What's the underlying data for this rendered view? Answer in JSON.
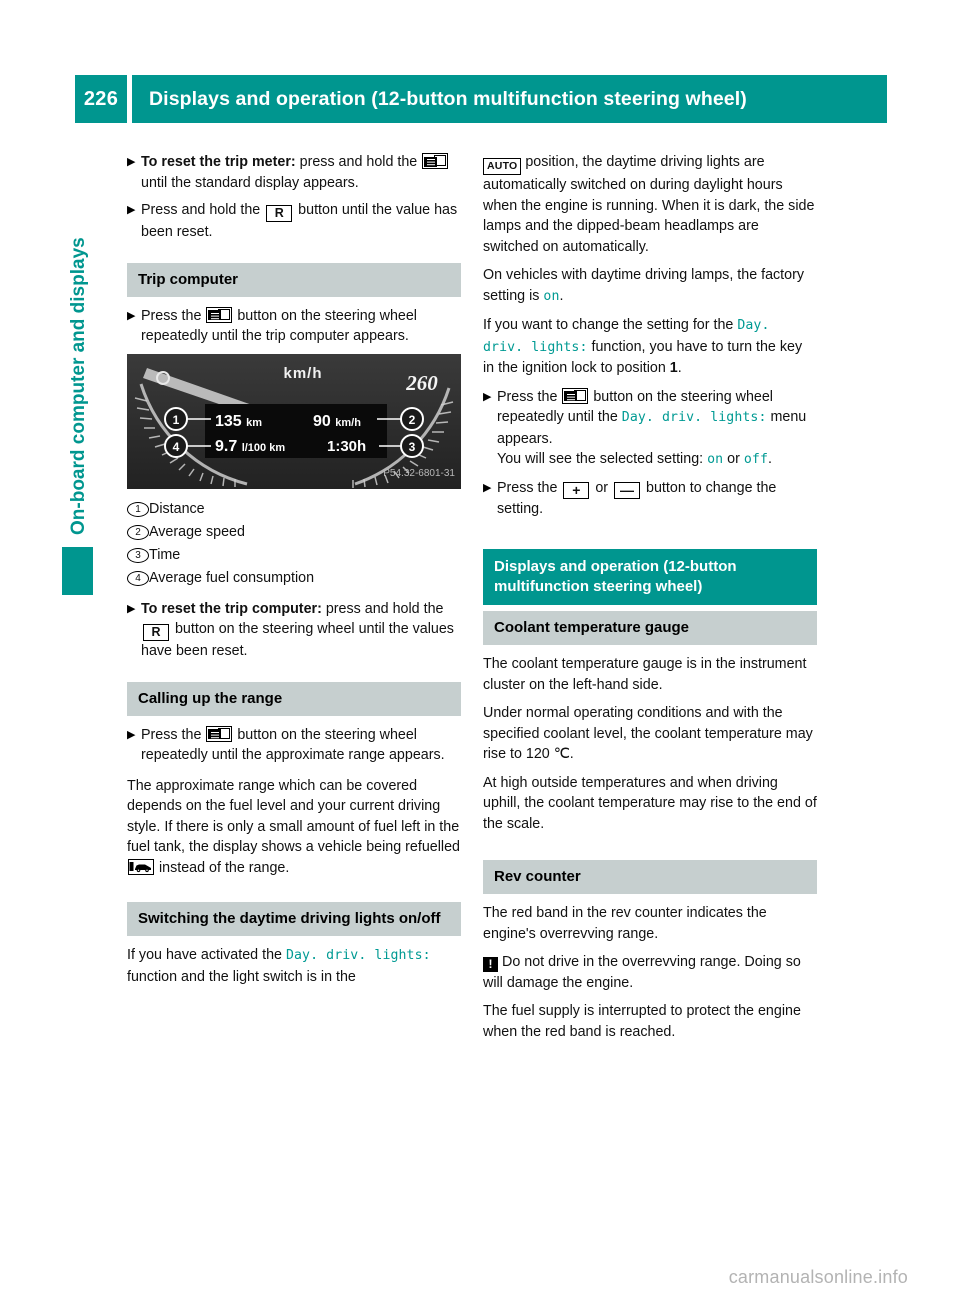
{
  "header": {
    "page_number": "226",
    "title": "Displays and operation (12-button multifunction steering wheel)",
    "accent_color": "#00968f"
  },
  "side_tab": {
    "label": "On-board computer and displays",
    "color": "#00968f"
  },
  "icons": {
    "menu_button": "menu-display-button-icon",
    "reset_button": "R",
    "auto_badge": "AUTO",
    "plus_button": "+",
    "minus_button": "—",
    "refuel": "refuel-vehicle-icon",
    "warning": "!"
  },
  "left_column": {
    "steps_top": [
      {
        "marker": "▶",
        "bold_lead": "To reset the trip meter:",
        "text_before_icon": " press and hold the ",
        "icon": "menu-display-button-icon",
        "text_after_icon": " until the standard display appears."
      },
      {
        "marker": "▶",
        "bold_lead": "",
        "text_before_icon": "Press and hold the ",
        "icon": "R",
        "text_after_icon": " button until the value has been reset."
      }
    ],
    "trip_computer": {
      "heading": "Trip computer",
      "step": {
        "marker": "▶",
        "text_before_icon": "Press the ",
        "icon": "menu-display-button-icon",
        "text_after_icon": " button on the steering wheel repeatedly until the trip computer appears."
      },
      "figure": {
        "unit_label": "km/h",
        "max_speed": "260",
        "distance": "135 km",
        "average_speed": "90 km/h",
        "consumption": "9.7 l/100 km",
        "time": "1:30h",
        "image_code": "P54.32-6801-31",
        "callouts": [
          "1",
          "2",
          "3",
          "4"
        ]
      },
      "legend": [
        {
          "num": "1",
          "symbol": ":",
          "label": "Distance"
        },
        {
          "num": "2",
          "symbol": ";",
          "label": "Average speed"
        },
        {
          "num": "3",
          "symbol": "=",
          "label": "Time"
        },
        {
          "num": "4",
          "symbol": "?",
          "label": "Average fuel consumption"
        }
      ],
      "reset_step": {
        "marker": "▶",
        "bold_lead": "To reset the trip computer:",
        "text_before_icon": " press and hold the ",
        "icon": "R",
        "text_after_icon": " button on the steering wheel until the values have been reset."
      }
    },
    "range": {
      "heading": "Calling up the range",
      "step": {
        "marker": "▶",
        "text_before_icon": "Press the ",
        "icon": "menu-display-button-icon",
        "text_after_icon": " button on the steering wheel repeatedly until the approximate range appears."
      },
      "paragraph_before_icon": "The approximate range which can be covered depends on the fuel level and your current driving style. If there is only a small amount of fuel left in the fuel tank, the display shows a vehicle being refuelled ",
      "paragraph_after_icon": " instead of the range."
    },
    "daytime_lights": {
      "heading": "Switching the daytime driving lights on/off",
      "text_before_ui": "If you have activated the ",
      "ui_string": "Day. driv. lights:",
      "text_after_ui": " function and the light switch is in the"
    }
  },
  "right_column": {
    "continuation": {
      "icon": "AUTO",
      "paragraph_1": " position, the daytime driving lights are automatically switched on during daylight hours when the engine is running. When it is dark, the side lamps and the dipped-beam headlamps are switched on automatically.",
      "paragraph_2_before": "On vehicles with daytime driving lamps, the factory setting is ",
      "paragraph_2_ui": "on",
      "paragraph_2_after": ".",
      "paragraph_3_before": "If you want to change the setting for the ",
      "paragraph_3_ui": "Day. driv. lights:",
      "paragraph_3_mid": " function, you have to turn the key in the ignition lock to position ",
      "paragraph_3_bold": "1",
      "paragraph_3_after": "."
    },
    "steps": [
      {
        "marker": "▶",
        "text_before_icon": "Press the ",
        "icon": "menu-display-button-icon",
        "text_mid": " button on the steering wheel repeatedly until the ",
        "ui_string": "Day. driv. lights:",
        "text_after_ui": " menu appears.",
        "sub_before": "You will see the selected setting: ",
        "sub_ui_1": "on",
        "sub_mid": " or ",
        "sub_ui_2": "off",
        "sub_after": "."
      },
      {
        "marker": "▶",
        "text_before_icon": "Press the ",
        "icon_1": "+",
        "text_mid": " or ",
        "icon_2": "—",
        "text_after": " button to change the setting."
      }
    ],
    "teal_heading": "Displays and operation (12-button multifunction steering wheel)",
    "coolant": {
      "heading": "Coolant temperature gauge",
      "paragraph_1": "The coolant temperature gauge is in the instrument cluster on the left-hand side.",
      "paragraph_2": "Under normal operating conditions and with the specified coolant level, the coolant temperature may rise to 120 ℃.",
      "paragraph_3": "At high outside temperatures and when driving uphill, the coolant temperature may rise to the end of the scale."
    },
    "rev_counter": {
      "heading": "Rev counter",
      "paragraph_1": "The red band in the rev counter indicates the engine's overrevving range.",
      "warning_icon": "!",
      "warning_text": "Do not drive in the overrevving range. Doing so will damage the engine.",
      "paragraph_2": "The fuel supply is interrupted to protect the engine when the red band is reached."
    }
  },
  "footer": {
    "watermark": "carmanualsonline.info"
  }
}
